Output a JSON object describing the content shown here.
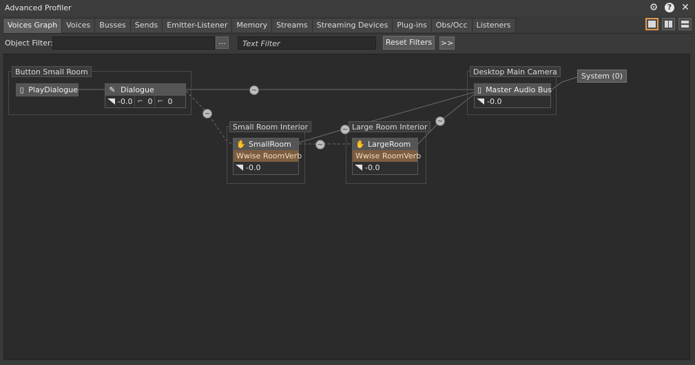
{
  "window": {
    "title": "Advanced Profiler"
  },
  "titlebar_icons": [
    "gear-icon",
    "help-icon",
    "close-icon"
  ],
  "tabs": [
    "Voices Graph",
    "Voices",
    "Busses",
    "Sends",
    "Emitter-Listener",
    "Memory",
    "Streams",
    "Streaming Devices",
    "Plug-ins",
    "Obs/Occ",
    "Listeners"
  ],
  "active_tab": "Voices Graph",
  "filters": {
    "object_filter_label": "Object Filter:",
    "object_filter_value": "",
    "browse_label": "...",
    "text_filter_placeholder": "Text Filter",
    "reset_label": "Reset Filters",
    "more_label": ">>"
  },
  "graph": {
    "groups": {
      "button_small_room": "Button Small Room",
      "small_room_interior": "Small Room Interior",
      "large_room_interior": "Large Room Interior",
      "desktop_main_camera": "Desktop Main Camera"
    },
    "nodes": {
      "play_dialogue": {
        "name": "PlayDialogue"
      },
      "dialogue": {
        "name": "Dialogue",
        "volume": "-0.0",
        "lpf": "0",
        "hpf": "0"
      },
      "small_room": {
        "name": "SmallRoom",
        "effect": "Wwise RoomVerb",
        "volume": "-0.0"
      },
      "large_room": {
        "name": "LargeRoom",
        "effect": "Wwise RoomVerb",
        "volume": "-0.0"
      },
      "master_audio_bus": {
        "name": "Master Audio Bus",
        "volume": "-0.0"
      }
    },
    "system": "System (0)",
    "colors": {
      "canvas": "#2b2b2b",
      "effect_row": "#7c5d3f",
      "accent": "#e09a48"
    }
  }
}
